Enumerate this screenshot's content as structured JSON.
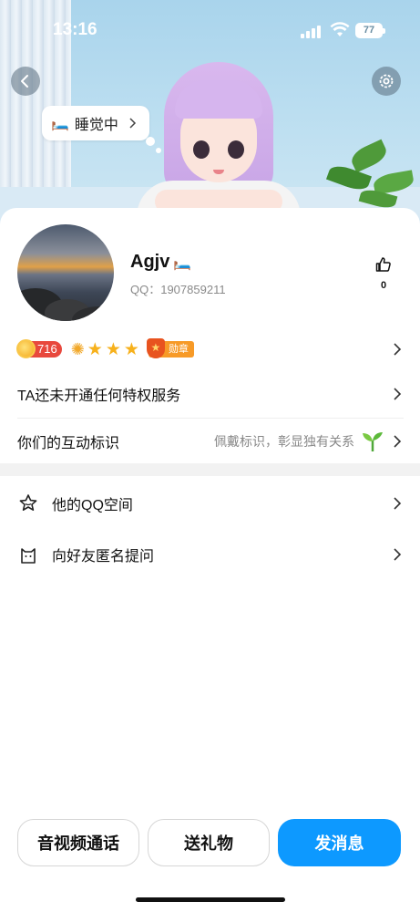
{
  "status_bar": {
    "time": "13:16",
    "battery": "77"
  },
  "header": {
    "back_icon": "chevron-left-icon",
    "settings_icon": "gear-icon",
    "status_bubble": {
      "emoji": "🛏️",
      "text": "睡觉中"
    }
  },
  "profile": {
    "nickname": "Agjv",
    "nickname_emoji": "🛏️",
    "qq_label": "QQ：1907859211",
    "like_count": "0"
  },
  "badges": {
    "coin_value": "716",
    "stars": 3,
    "medal_label": "勋章"
  },
  "rows": {
    "privilege": "TA还未开通任何特权服务",
    "interaction_label": "你们的互动标识",
    "interaction_hint": "佩戴标识，彰显独有关系",
    "qzone": "他的QQ空间",
    "anonymous_question": "向好友匿名提问"
  },
  "buttons": {
    "call": "音视频通话",
    "gift": "送礼物",
    "message": "发消息"
  },
  "colors": {
    "primary": "#0d99ff",
    "banner": "#a9d4ec",
    "coin": "#e8483d",
    "medal": "#f79a27"
  }
}
